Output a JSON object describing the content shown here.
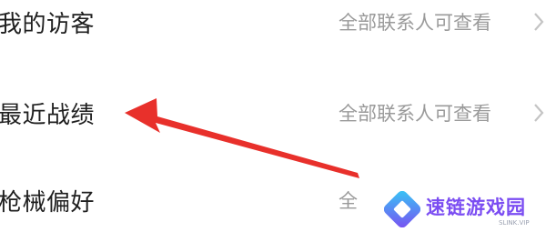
{
  "settings_rows": [
    {
      "label": "我的访客",
      "value": "全部联系人可查看"
    },
    {
      "label": "最近战绩",
      "value": "全部联系人可查看"
    },
    {
      "label": "枪械偏好",
      "value": "全"
    }
  ],
  "annotation": {
    "icon": "red-arrow-icon",
    "color": "#e8302b"
  },
  "watermark": {
    "brand": "速链游戏园",
    "url": "SLINK.VIP",
    "color": "#7b4df2"
  }
}
